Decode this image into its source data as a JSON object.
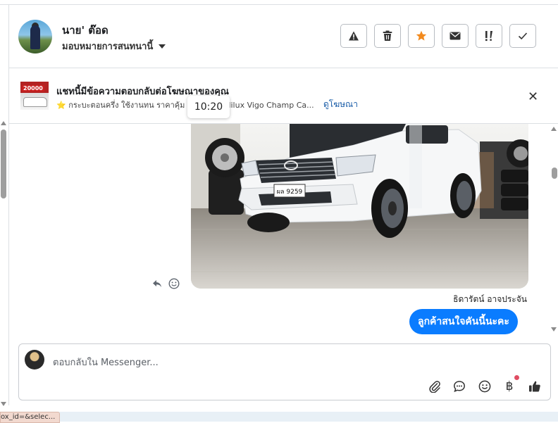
{
  "contact": {
    "name": "นาย' ต๊อด",
    "assign_label": "มอบหมายการสนทนานี้"
  },
  "header_actions": [
    {
      "icon": "warning-icon"
    },
    {
      "icon": "trash-icon"
    },
    {
      "icon": "star-icon",
      "color": "#f28a1e"
    },
    {
      "icon": "envelope-icon"
    },
    {
      "icon": "priority-icon"
    },
    {
      "icon": "check-icon"
    }
  ],
  "ad": {
    "thumbnail_price": "20000",
    "title": "แชทนี้มีข้อความตอบกลับต่อโฆษณาของคุณ",
    "subtitle": "⭐ กระบะตอนครึ่ง ใช้งานทน ราคาคุ้ม ... Toyota Hilux Vigo Champ Ca...",
    "link": "ดูโฆษณา"
  },
  "tooltip": "10:20",
  "chat": {
    "photo_plate": "ผล 9259",
    "sender_name": "ธิดารัตน์ อาจประจัน",
    "message": "ลูกค้าสนใจคันนี้นะคะ"
  },
  "composer": {
    "placeholder": "ตอบกลับใน Messenger..."
  },
  "status_chip": "ox_id=&selec...",
  "colors": {
    "bubble": "#0a7cff",
    "link": "#1a5da8",
    "star": "#f28a1e"
  }
}
